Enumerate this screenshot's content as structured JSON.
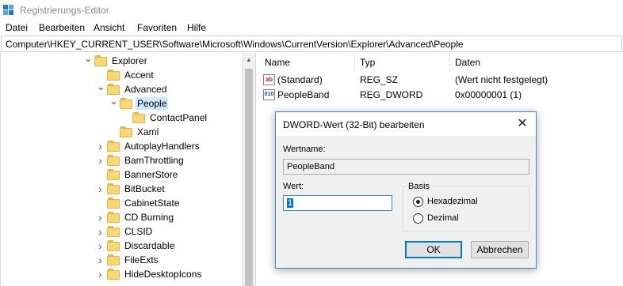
{
  "window": {
    "title": "Registrierungs-Editor"
  },
  "menu": [
    "Datei",
    "Bearbeiten",
    "Ansicht",
    "Favoriten",
    "Hilfe"
  ],
  "address": "Computer\\HKEY_CURRENT_USER\\Software\\Microsoft\\Windows\\CurrentVersion\\Explorer\\Advanced\\People",
  "tree": {
    "items": [
      {
        "label": "Explorer",
        "expander": "expanded",
        "depth": 0
      },
      {
        "label": "Accent",
        "expander": "none",
        "depth": 1
      },
      {
        "label": "Advanced",
        "expander": "expanded",
        "depth": 1
      },
      {
        "label": "People",
        "expander": "expanded",
        "depth": 2,
        "selected": true
      },
      {
        "label": "ContactPanel",
        "expander": "none",
        "depth": 3
      },
      {
        "label": "Xaml",
        "expander": "none",
        "depth": 2
      },
      {
        "label": "AutoplayHandlers",
        "expander": "collapsed",
        "depth": 1
      },
      {
        "label": "BamThrottling",
        "expander": "collapsed",
        "depth": 1
      },
      {
        "label": "BannerStore",
        "expander": "none",
        "depth": 1
      },
      {
        "label": "BitBucket",
        "expander": "collapsed",
        "depth": 1
      },
      {
        "label": "CabinetState",
        "expander": "none",
        "depth": 1
      },
      {
        "label": "CD Burning",
        "expander": "collapsed",
        "depth": 1
      },
      {
        "label": "CLSID",
        "expander": "collapsed",
        "depth": 1
      },
      {
        "label": "Discardable",
        "expander": "collapsed",
        "depth": 1
      },
      {
        "label": "FileExts",
        "expander": "collapsed",
        "depth": 1
      },
      {
        "label": "HideDesktopIcons",
        "expander": "collapsed",
        "depth": 1
      }
    ]
  },
  "list": {
    "columns": [
      "Name",
      "Typ",
      "Daten"
    ],
    "rows": [
      {
        "name": "(Standard)",
        "type": "REG_SZ",
        "data": "(Wert nicht festgelegt)",
        "icon": "string-value-icon",
        "glyph": "ab"
      },
      {
        "name": "PeopleBand",
        "type": "REG_DWORD",
        "data": "0x00000001 (1)",
        "icon": "dword-value-icon",
        "glyph": "010"
      }
    ]
  },
  "dialog": {
    "title": "DWORD-Wert (32-Bit) bearbeiten",
    "close_glyph": "✕",
    "name_label": "Wertname:",
    "name_value": "PeopleBand",
    "value_label": "Wert:",
    "value": "1",
    "base_label": "Basis",
    "base_options": [
      "Hexadezimal",
      "Dezimal"
    ],
    "base_selected": "Hexadezimal",
    "ok_label": "OK",
    "cancel_label": "Abbrechen"
  },
  "colors": {
    "selection": "#cce8ff",
    "accent": "#0078d7",
    "folder": "#f8d775"
  }
}
